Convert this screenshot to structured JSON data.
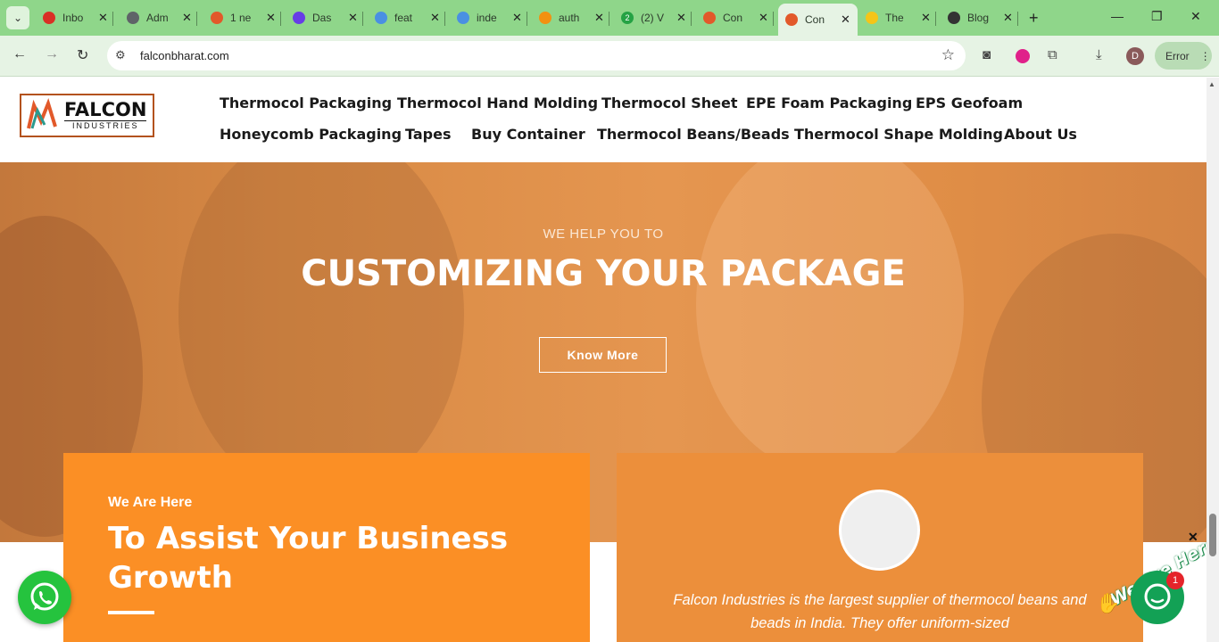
{
  "browser": {
    "tabs": [
      {
        "label": "Inbo",
        "icon": "gmail-icon",
        "color": "#d93025"
      },
      {
        "label": "Adm",
        "icon": "globe-icon",
        "color": "#5f6368"
      },
      {
        "label": "1 ne",
        "icon": "falcon-icon",
        "color": "#e2592a"
      },
      {
        "label": "Das",
        "icon": "hostinger-icon",
        "color": "#673de6"
      },
      {
        "label": "feat",
        "icon": "globe-blue-icon",
        "color": "#4a90e2"
      },
      {
        "label": "inde",
        "icon": "globe-blue-icon",
        "color": "#4a90e2"
      },
      {
        "label": "auth",
        "icon": "pma-icon",
        "color": "#f29111"
      },
      {
        "label": "(2) V",
        "icon": "whatsapp-count-icon",
        "color": "#25a244",
        "badge": "2"
      },
      {
        "label": "Con",
        "icon": "falcon-icon",
        "color": "#e2592a"
      },
      {
        "label": "Con",
        "icon": "falcon-icon",
        "color": "#e2592a",
        "active": true
      },
      {
        "label": "The",
        "icon": "emoji-icon",
        "color": "#f5c518"
      },
      {
        "label": "Blog",
        "icon": "openai-icon",
        "color": "#333333"
      }
    ],
    "url": "falconbharat.com",
    "error_label": "Error",
    "profile_initial": "D"
  },
  "site": {
    "logo": {
      "brand": "FALCON",
      "sub": "INDUSTRIES"
    },
    "menu": [
      "Thermocol Packaging",
      "Thermocol Hand Molding",
      "Thermocol Sheet",
      "EPE Foam Packaging",
      "EPS Geofoam",
      "Honeycomb Packaging",
      "Tapes",
      "Buy Container",
      "Thermocol Beans/Beads",
      "Thermocol Shape Molding",
      "About Us"
    ]
  },
  "hero": {
    "eyebrow": "WE HELP YOU TO",
    "headline": "CUSTOMIZING YOUR PACKAGE",
    "cta": "Know More"
  },
  "card_left": {
    "kicker": "We Are Here",
    "heading": "To Assist Your Business Growth"
  },
  "card_right": {
    "quote": "Falcon Industries is the largest supplier of thermocol beans and beads in India. They offer uniform-sized"
  },
  "widgets": {
    "chat_badge": "1",
    "chat_tagline": "We Are Here!"
  },
  "colors": {
    "accent_orange": "#fb8f25",
    "chrome_green": "#8fd68a",
    "whatsapp_green": "#25c33e"
  }
}
